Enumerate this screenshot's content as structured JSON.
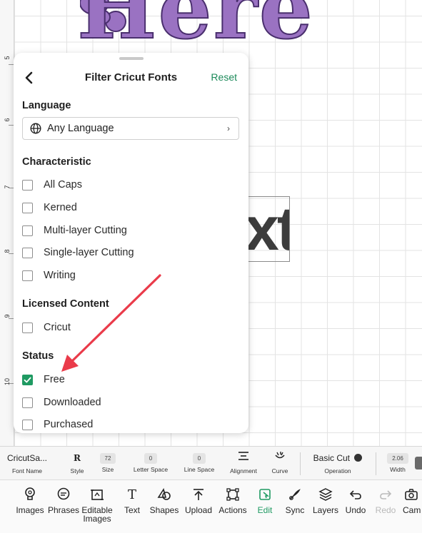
{
  "canvas": {
    "ruler_ticks": [
      "5",
      "6",
      "7",
      "8",
      "9",
      "10"
    ],
    "design_text_top": "Here",
    "design_text_box": "xt",
    "design_color": "#9a72c2"
  },
  "filter_panel": {
    "title": "Filter Cricut Fonts",
    "back_icon": "chevron-left-icon",
    "reset_label": "Reset",
    "accent_color": "#1c8a5a",
    "language": {
      "heading": "Language",
      "selected": "Any Language",
      "icon": "globe-icon"
    },
    "characteristic": {
      "heading": "Characteristic",
      "options": [
        {
          "label": "All Caps",
          "checked": false
        },
        {
          "label": "Kerned",
          "checked": false
        },
        {
          "label": "Multi-layer Cutting",
          "checked": false
        },
        {
          "label": "Single-layer Cutting",
          "checked": false
        },
        {
          "label": "Writing",
          "checked": false
        }
      ]
    },
    "licensed": {
      "heading": "Licensed Content",
      "options": [
        {
          "label": "Cricut",
          "checked": false
        }
      ]
    },
    "status": {
      "heading": "Status",
      "options": [
        {
          "label": "Free",
          "checked": true
        },
        {
          "label": "Downloaded",
          "checked": false
        },
        {
          "label": "Purchased",
          "checked": false
        }
      ]
    }
  },
  "properties_bar": {
    "font_name": {
      "value": "CricutSa...",
      "label": "Font Name"
    },
    "style": {
      "value": "R",
      "label": "Style"
    },
    "size": {
      "value": "72",
      "label": "Size"
    },
    "letter_space": {
      "value": "0",
      "label": "Letter Space"
    },
    "line_space": {
      "value": "0",
      "label": "Line Space"
    },
    "alignment": {
      "label": "Alignment"
    },
    "curve": {
      "label": "Curve"
    },
    "operation": {
      "value": "Basic Cut",
      "label": "Operation"
    },
    "width": {
      "value": "2.06",
      "label": "Width"
    }
  },
  "toolbar": {
    "items": [
      {
        "label": "Images",
        "icon": "lightbulb-icon"
      },
      {
        "label": "Phrases",
        "icon": "speech-bubble-icon"
      },
      {
        "label": "Editable Images",
        "icon": "editable-image-icon"
      },
      {
        "label": "Text",
        "icon": "text-icon"
      },
      {
        "label": "Shapes",
        "icon": "shapes-icon"
      },
      {
        "label": "Upload",
        "icon": "upload-icon"
      },
      {
        "label": "Actions",
        "icon": "actions-icon"
      },
      {
        "label": "Edit",
        "icon": "edit-icon",
        "active": true
      },
      {
        "label": "Sync",
        "icon": "sync-icon"
      },
      {
        "label": "Layers",
        "icon": "layers-icon"
      },
      {
        "label": "Undo",
        "icon": "undo-icon"
      },
      {
        "label": "Redo",
        "icon": "redo-icon",
        "disabled": true
      },
      {
        "label": "Cam",
        "icon": "camera-icon"
      }
    ]
  }
}
